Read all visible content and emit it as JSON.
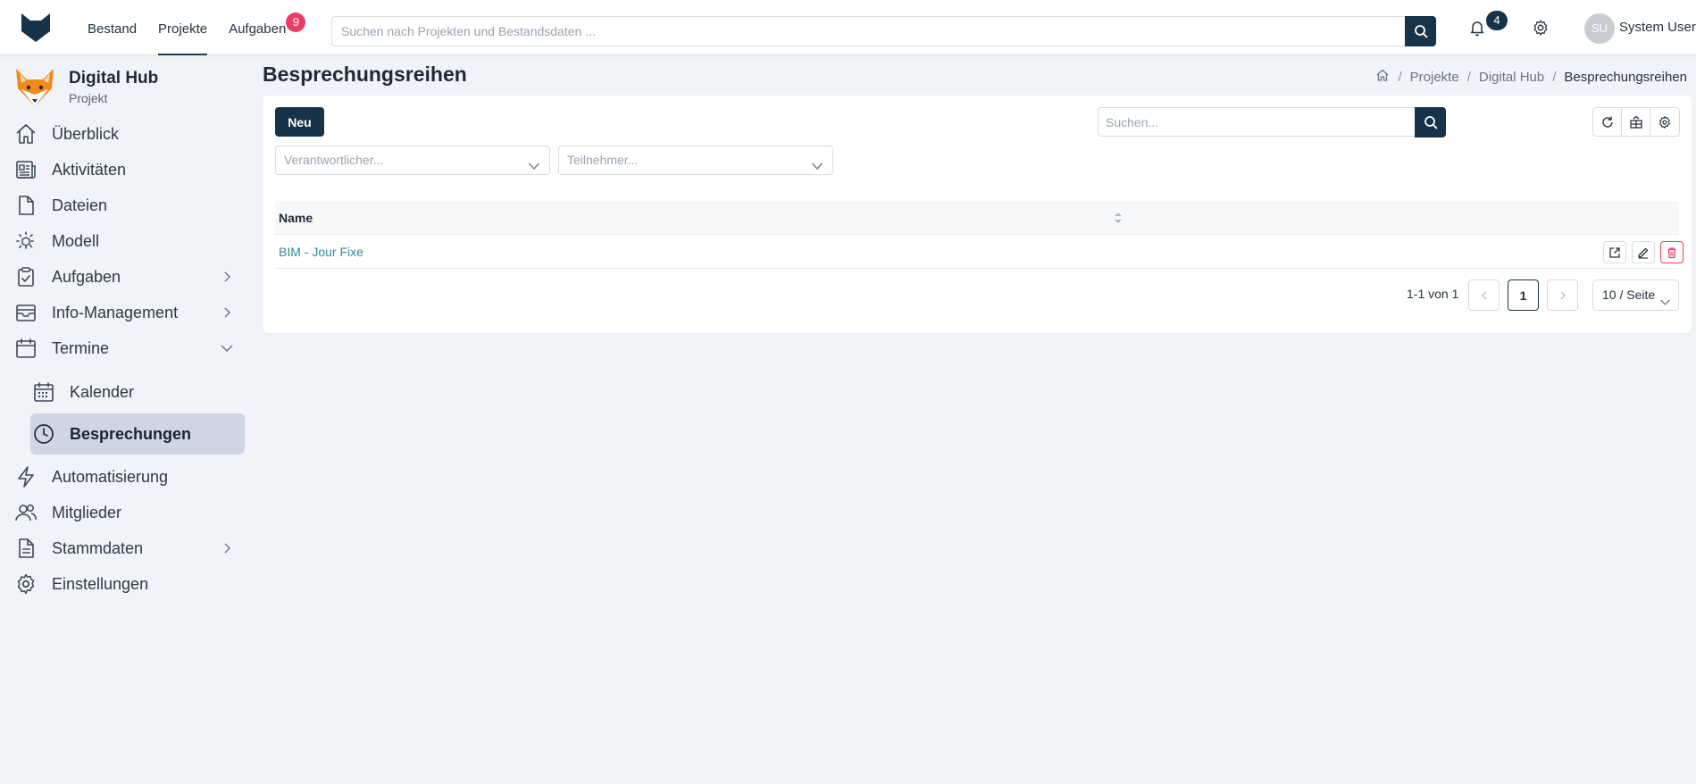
{
  "topbar": {
    "nav": [
      {
        "label": "Bestand",
        "active": false
      },
      {
        "label": "Projekte",
        "active": true
      },
      {
        "label": "Aufgaben",
        "active": false,
        "badge": "9"
      }
    ],
    "search_placeholder": "Suchen nach Projekten und Bestandsdaten ...",
    "notification_count": "4",
    "user_initials": "SU",
    "user_name": "System User"
  },
  "sidebar": {
    "title": "Digital Hub",
    "subtitle": "Projekt",
    "items": [
      {
        "label": "Überblick",
        "icon": "home-icon"
      },
      {
        "label": "Aktivitäten",
        "icon": "newspaper-icon"
      },
      {
        "label": "Dateien",
        "icon": "file-icon"
      },
      {
        "label": "Modell",
        "icon": "model-icon"
      },
      {
        "label": "Aufgaben",
        "icon": "clipboard-check-icon",
        "chevron": "right"
      },
      {
        "label": "Info-Management",
        "icon": "inbox-icon",
        "chevron": "right"
      },
      {
        "label": "Termine",
        "icon": "calendar-icon",
        "chevron": "down"
      },
      {
        "label": "Kalender",
        "icon": "calendar-grid-icon",
        "sub": true
      },
      {
        "label": "Besprechungen",
        "icon": "clock-icon",
        "sub": true,
        "selected": true
      },
      {
        "label": "Automatisierung",
        "icon": "lightning-icon"
      },
      {
        "label": "Mitglieder",
        "icon": "users-icon"
      },
      {
        "label": "Stammdaten",
        "icon": "document-icon",
        "chevron": "right"
      },
      {
        "label": "Einstellungen",
        "icon": "gear-icon"
      }
    ]
  },
  "main": {
    "title": "Besprechungsreihen",
    "breadcrumb": [
      "Projekte",
      "Digital Hub",
      "Besprechungsreihen"
    ],
    "new_button": "Neu",
    "search_placeholder": "Suchen...",
    "filters": {
      "responsible_placeholder": "Verantwortlicher...",
      "participants_placeholder": "Teilnehmer..."
    },
    "table": {
      "column_name": "Name",
      "rows": [
        {
          "name": "BIM - Jour Fixe"
        }
      ]
    },
    "pagination": {
      "range": "1-1 von 1",
      "current_page": "1",
      "page_size": "10 / Seite"
    }
  },
  "colors": {
    "primary": "#163349",
    "link": "#2f8c9a",
    "danger": "#ea3e64",
    "selected_bg": "#cdd6e2",
    "page_bg": "#f0f3f8"
  }
}
